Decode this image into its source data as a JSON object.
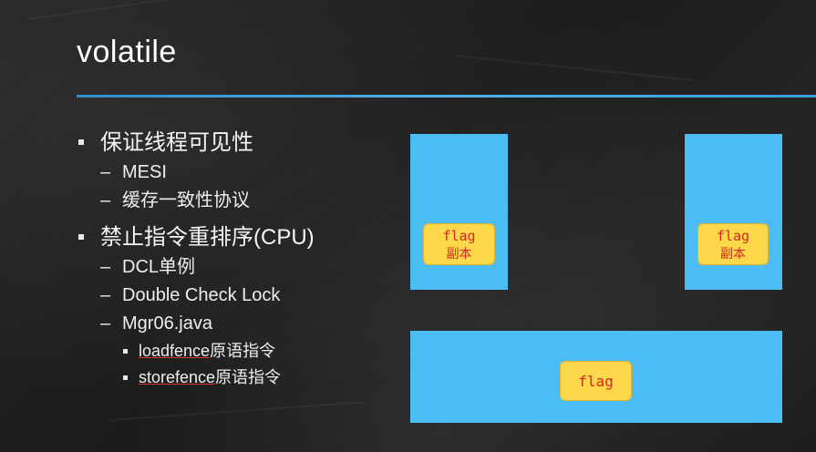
{
  "slide": {
    "title": "volatile",
    "bullets": [
      {
        "text": "保证线程可见性",
        "children": [
          {
            "text": "MESI"
          },
          {
            "text": "缓存一致性协议"
          }
        ]
      },
      {
        "text": "禁止指令重排序(CPU)",
        "children": [
          {
            "text": "DCL单例"
          },
          {
            "text": "Double Check Lock"
          },
          {
            "text": "Mgr06.java"
          }
        ],
        "grandchildren": [
          {
            "underlined": "loadfence",
            "rest": "原语指令"
          },
          {
            "underlined": "storefence",
            "rest": "原语指令"
          }
        ]
      }
    ]
  },
  "diagram": {
    "cpu_left": {
      "flag_label": "flag",
      "copy_label": "副本"
    },
    "cpu_right": {
      "flag_label": "flag",
      "copy_label": "副本"
    },
    "memory": {
      "flag_label": "flag"
    },
    "colors": {
      "block": "#4cbcf5",
      "flag_fill": "#fcd84a",
      "flag_text": "#d22a1e",
      "title_rule": "#3aa0dc"
    }
  }
}
